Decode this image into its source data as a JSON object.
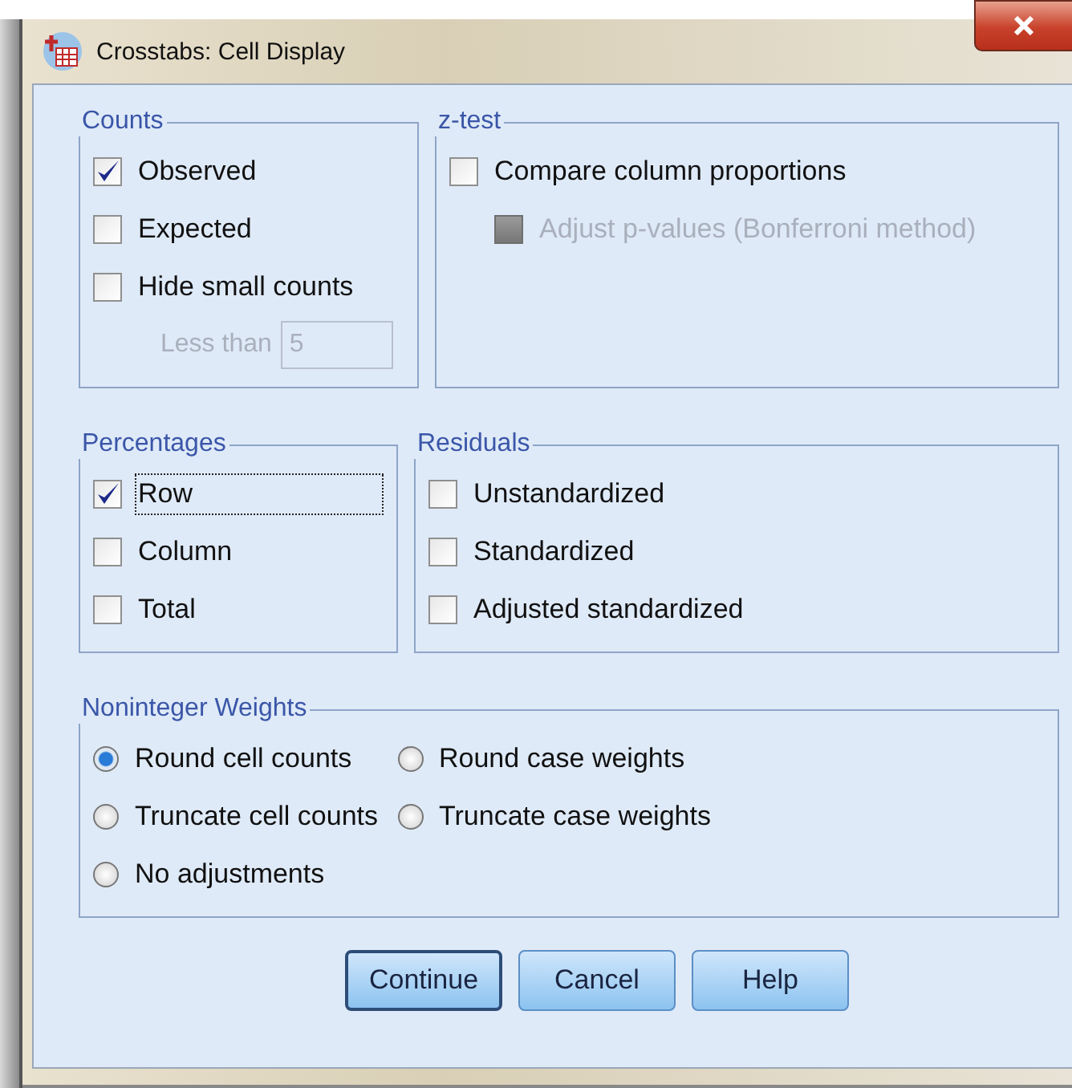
{
  "window": {
    "title": "Crosstabs: Cell Display"
  },
  "counts": {
    "title": "Counts",
    "options": [
      {
        "label": "Observed",
        "checked": true,
        "disabled": false,
        "focused": false
      },
      {
        "label": "Expected",
        "checked": false,
        "disabled": false,
        "focused": false
      },
      {
        "label": "Hide small counts",
        "checked": false,
        "disabled": false,
        "focused": false
      }
    ],
    "less_than": {
      "label": "Less than",
      "value": "5",
      "disabled": true
    }
  },
  "z_test": {
    "title": "z-test",
    "options": [
      {
        "label": "Compare column proportions",
        "checked": false,
        "disabled": false,
        "focused": false,
        "indented": false
      },
      {
        "label": "Adjust p-values (Bonferroni method)",
        "checked": false,
        "disabled": true,
        "focused": false,
        "indented": true
      }
    ]
  },
  "percentages": {
    "title": "Percentages",
    "options": [
      {
        "label": "Row",
        "checked": true,
        "disabled": false,
        "focused": true
      },
      {
        "label": "Column",
        "checked": false,
        "disabled": false,
        "focused": false
      },
      {
        "label": "Total",
        "checked": false,
        "disabled": false,
        "focused": false
      }
    ]
  },
  "residuals": {
    "title": "Residuals",
    "options": [
      {
        "label": "Unstandardized",
        "checked": false,
        "disabled": false,
        "focused": false
      },
      {
        "label": "Standardized",
        "checked": false,
        "disabled": false,
        "focused": false
      },
      {
        "label": "Adjusted standardized",
        "checked": false,
        "disabled": false,
        "focused": false
      }
    ]
  },
  "noninteger_weights": {
    "title": "Noninteger Weights",
    "options": [
      {
        "label": "Round cell counts",
        "selected": true
      },
      {
        "label": "Round case weights",
        "selected": false
      },
      {
        "label": "Truncate cell counts",
        "selected": false
      },
      {
        "label": "Truncate case weights",
        "selected": false
      },
      {
        "label": "No adjustments",
        "selected": false
      }
    ]
  },
  "buttons": [
    {
      "label": "Continue",
      "default": true
    },
    {
      "label": "Cancel",
      "default": false
    },
    {
      "label": "Help",
      "default": false
    }
  ]
}
